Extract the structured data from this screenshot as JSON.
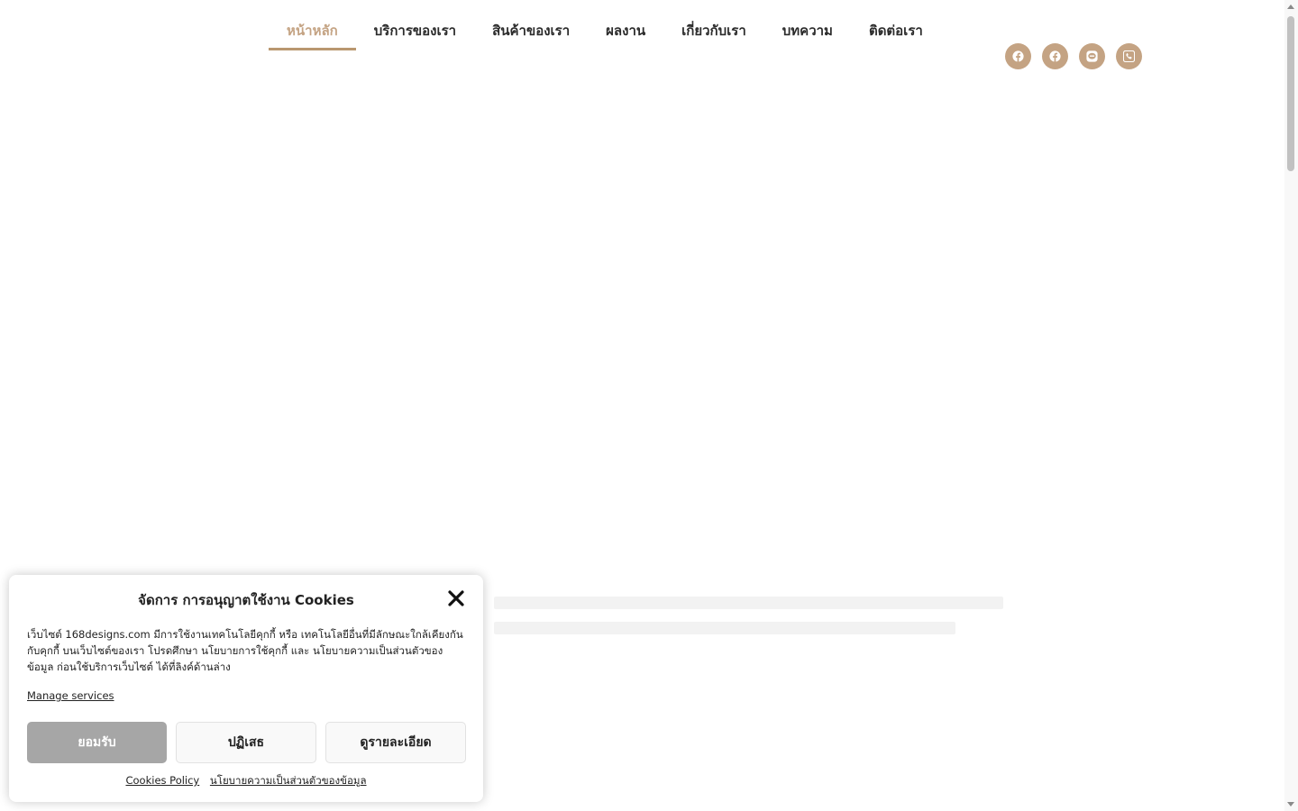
{
  "nav": {
    "items": [
      {
        "label": "หน้าหลัก",
        "active": true
      },
      {
        "label": "บริการของเรา",
        "active": false
      },
      {
        "label": "สินค้าของเรา",
        "active": false
      },
      {
        "label": "ผลงาน",
        "active": false
      },
      {
        "label": "เกี่ยวกับเรา",
        "active": false
      },
      {
        "label": "บทความ",
        "active": false
      },
      {
        "label": "ติดต่อเรา",
        "active": false
      }
    ]
  },
  "socials": [
    {
      "icon": "facebook-icon"
    },
    {
      "icon": "facebook-icon"
    },
    {
      "icon": "line-icon"
    },
    {
      "icon": "phone-icon"
    }
  ],
  "colors": {
    "accent": "#c4a383",
    "accent_underline": "#b9976f",
    "accept_button": "#a6a6a6"
  },
  "cookie": {
    "title": "จัดการ การอนุญาตใช้งาน Cookies",
    "body": "เว็บไซต์ 168designs.com มีการใช้งานเทคโนโลยีคุกกี้ หรือ เทคโนโลยีอื่นที่มีลักษณะใกล้เคียงกันกับคุกกี้ บนเว็บไซต์ของเรา โปรดศึกษา นโยบายการใช้คุกกี้ และ นโยบายความเป็นส่วนตัวของข้อมูล ก่อนใช้บริการเว็บไซต์ ได้ที่ลิงค์ด้านล่าง",
    "manage_label": "Manage services",
    "accept_label": "ยอมรับ",
    "deny_label": "ปฏิเสธ",
    "details_label": "ดูรายละเอียด",
    "policy_link": "Cookies Policy",
    "privacy_link": "นโยบายความเป็นส่วนตัวของข้อมูล"
  }
}
